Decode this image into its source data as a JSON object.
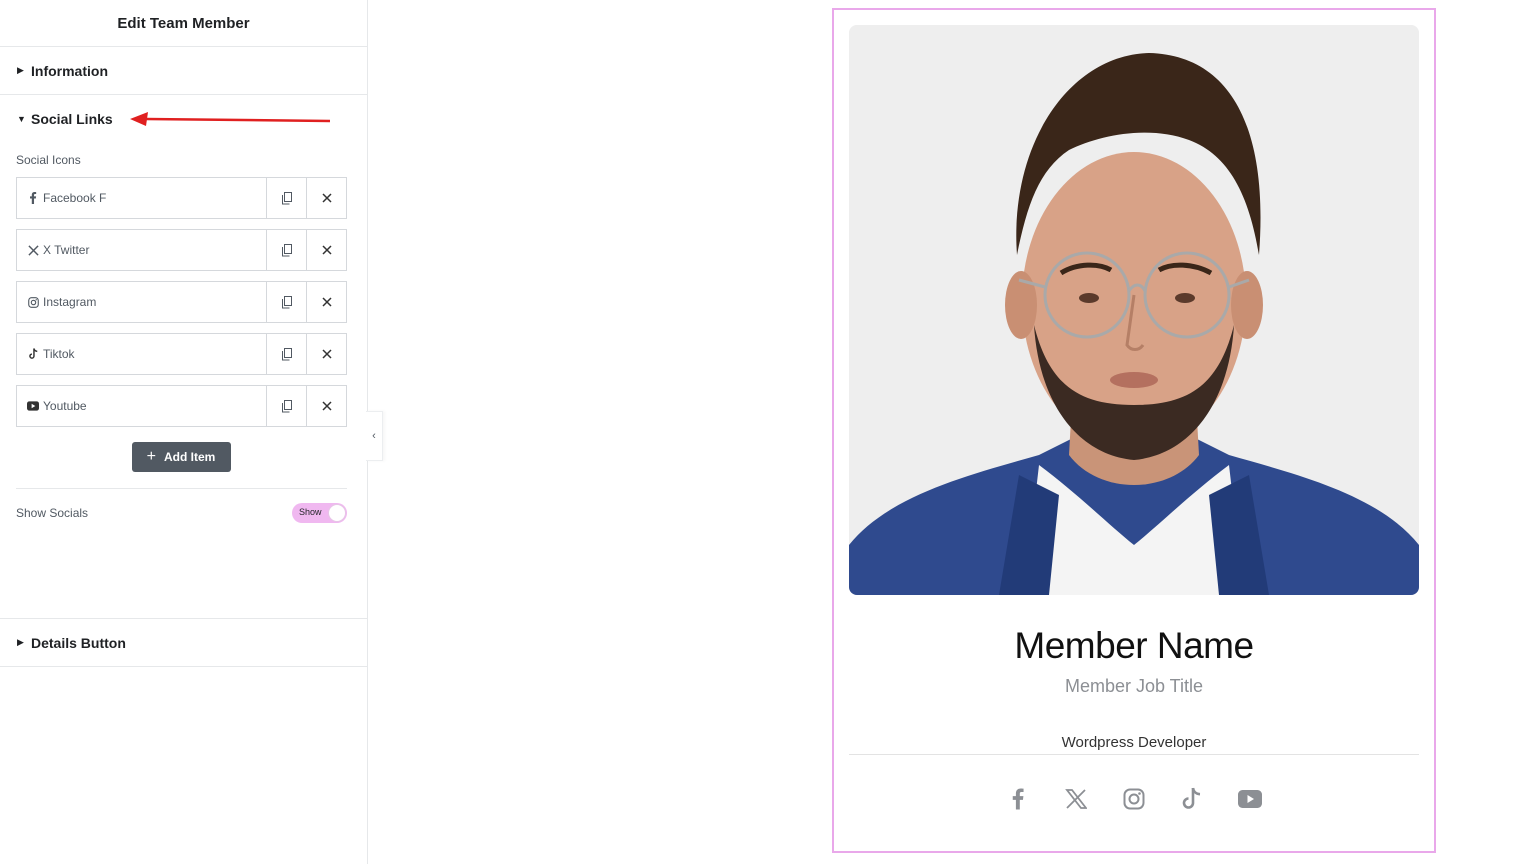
{
  "panel": {
    "title": "Edit Team Member",
    "sections": {
      "information": "Information",
      "social_links": "Social Links",
      "details_button": "Details Button"
    },
    "social_icons_label": "Social Icons",
    "social_items": [
      {
        "label": "Facebook F",
        "icon": "facebook-f-icon"
      },
      {
        "label": "X Twitter",
        "icon": "x-twitter-icon"
      },
      {
        "label": "Instagram",
        "icon": "instagram-icon"
      },
      {
        "label": "Tiktok",
        "icon": "tiktok-icon"
      },
      {
        "label": "Youtube",
        "icon": "youtube-icon"
      }
    ],
    "add_item_label": "Add Item",
    "show_socials_label": "Show Socials",
    "toggle_text": "Show",
    "toggle_on": true
  },
  "card": {
    "name": "Member Name",
    "job_title": "Member Job Title",
    "description": "Wordpress Developer",
    "socials": [
      "facebook-icon",
      "x-twitter-icon",
      "instagram-icon",
      "tiktok-icon",
      "youtube-icon"
    ]
  },
  "colors": {
    "outline": "#e9a8ea",
    "toggle": "#f0b8f0",
    "add_button": "#515962",
    "annotation_arrow": "#e02020"
  }
}
